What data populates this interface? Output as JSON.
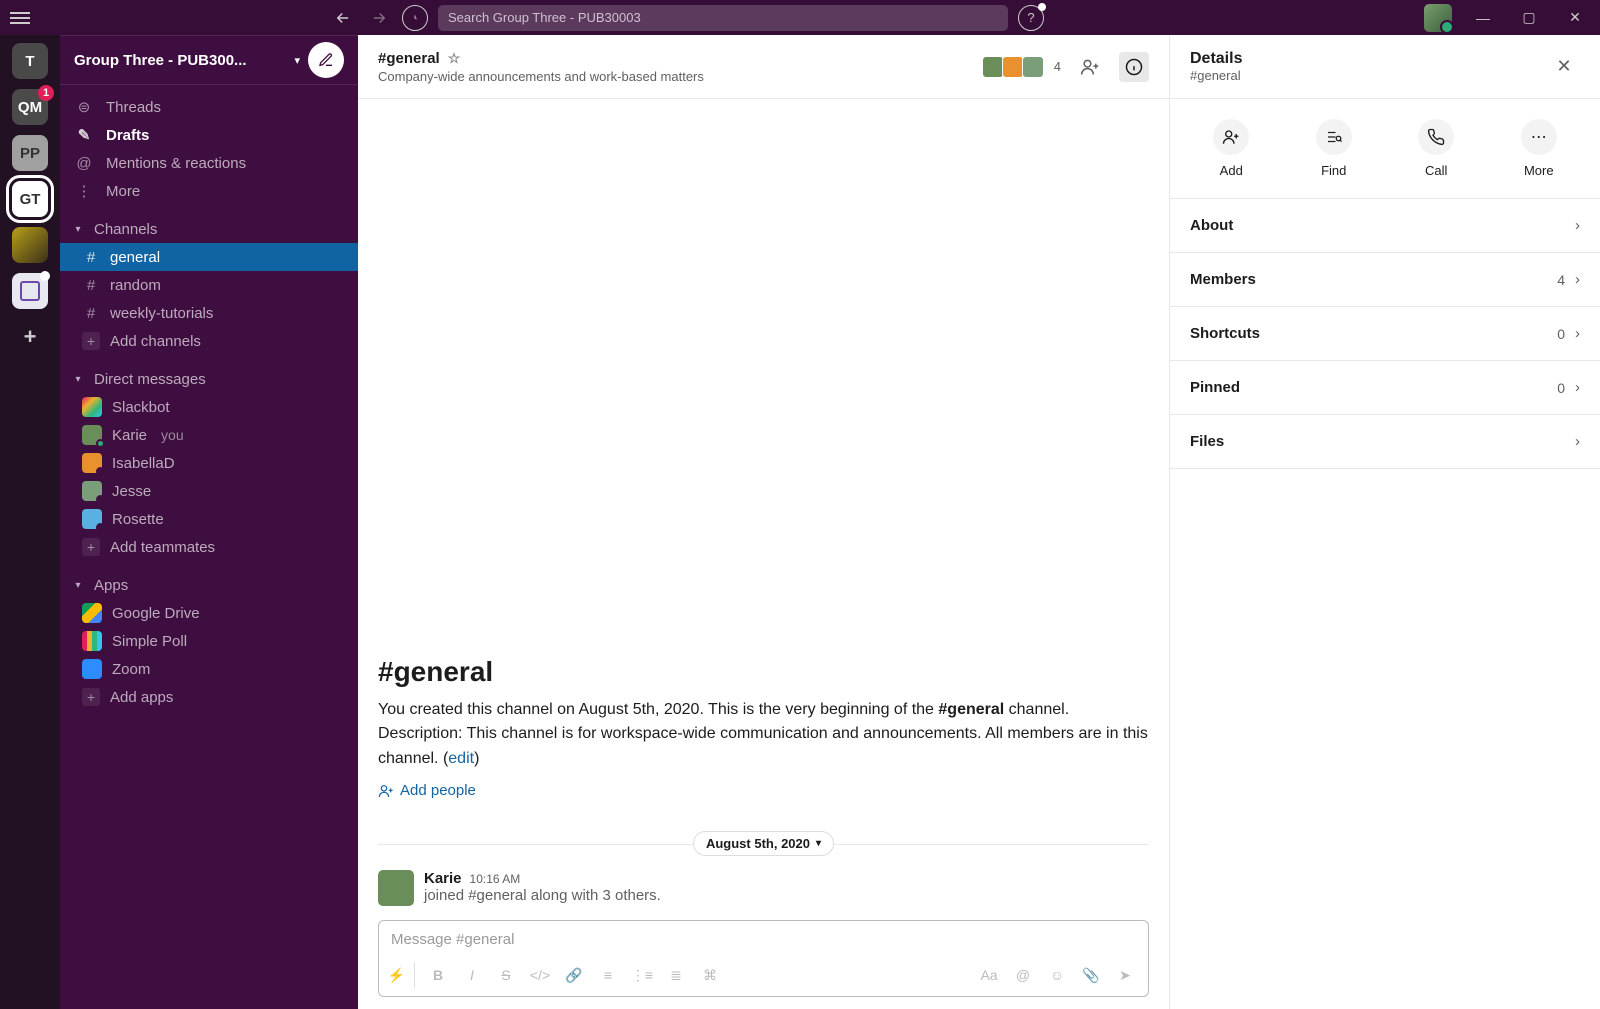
{
  "titlebar": {
    "search_placeholder": "Search Group Three - PUB30003"
  },
  "rail": {
    "workspaces": [
      {
        "label": "T"
      },
      {
        "label": "QM",
        "badge": "1"
      },
      {
        "label": "PP"
      },
      {
        "label": "GT"
      }
    ]
  },
  "sidebar": {
    "workspace_name": "Group Three - PUB300...",
    "nav": {
      "threads": "Threads",
      "drafts": "Drafts",
      "mentions": "Mentions & reactions",
      "more": "More"
    },
    "sections": {
      "channels": "Channels",
      "dms": "Direct messages",
      "apps": "Apps"
    },
    "channels": [
      {
        "name": "general",
        "active": true
      },
      {
        "name": "random"
      },
      {
        "name": "weekly-tutorials"
      }
    ],
    "add_channels": "Add channels",
    "dms": [
      {
        "name": "Slackbot"
      },
      {
        "name": "Karie",
        "you": "you"
      },
      {
        "name": "IsabellaD"
      },
      {
        "name": "Jesse"
      },
      {
        "name": "Rosette"
      }
    ],
    "add_teammates": "Add teammates",
    "apps": [
      {
        "name": "Google Drive"
      },
      {
        "name": "Simple Poll"
      },
      {
        "name": "Zoom"
      }
    ],
    "add_apps": "Add apps"
  },
  "channel_header": {
    "name": "#general",
    "topic": "Company-wide announcements and work-based matters",
    "member_count": "4"
  },
  "intro": {
    "heading": "#general",
    "line1": "You created this channel on August 5th, 2020. This is the very beginning of the ",
    "chan_name": "#general",
    "line2": " channel. Description: This channel is for workspace-wide communication and announcements. All members are in this channel. (",
    "edit": "edit",
    "line3": ")",
    "add_people": "Add people"
  },
  "date_divider": "August 5th, 2020",
  "message": {
    "name": "Karie",
    "time": "10:16 AM",
    "text": "joined #general along with 3 others."
  },
  "composer": {
    "placeholder": "Message #general"
  },
  "details": {
    "title": "Details",
    "subtitle": "#general",
    "actions": {
      "add": "Add",
      "find": "Find",
      "call": "Call",
      "more": "More"
    },
    "rows": {
      "about": "About",
      "members": "Members",
      "members_count": "4",
      "shortcuts": "Shortcuts",
      "shortcuts_count": "0",
      "pinned": "Pinned",
      "pinned_count": "0",
      "files": "Files"
    }
  }
}
